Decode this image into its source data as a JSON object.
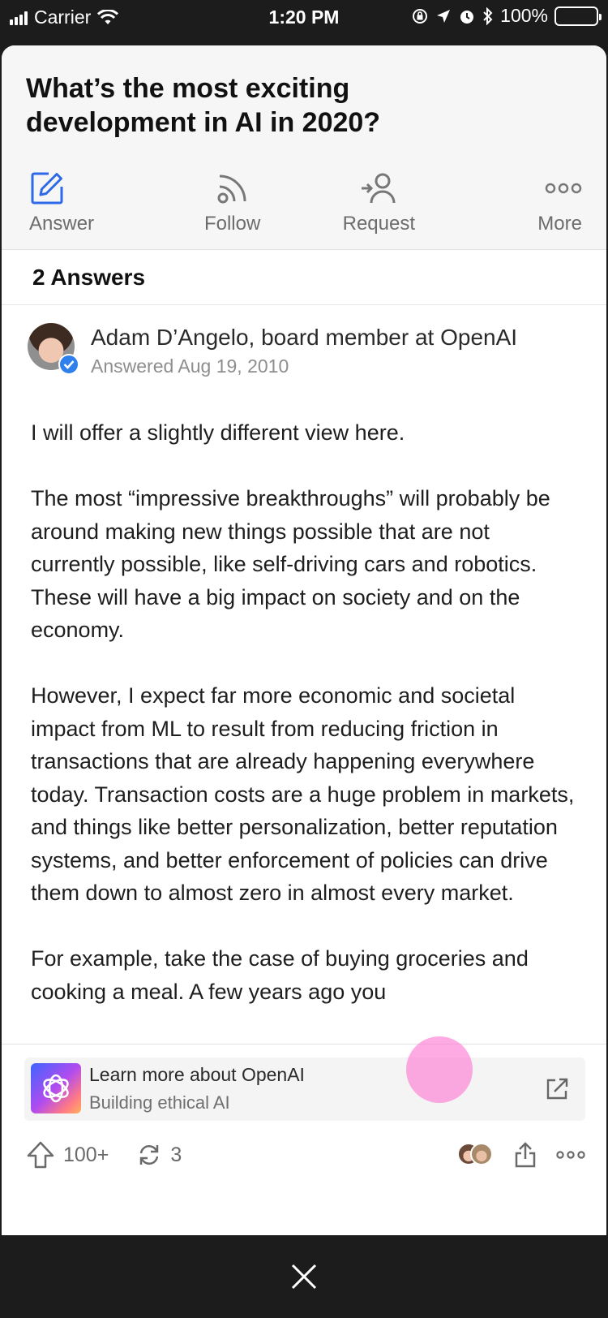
{
  "status_bar": {
    "carrier": "Carrier",
    "time": "1:20 PM",
    "battery": "100%"
  },
  "question": {
    "title": "What’s the most exciting development in AI in 2020?"
  },
  "actions": [
    {
      "label": "Answer",
      "icon": "edit-pencil-icon",
      "color": "#2e69e8"
    },
    {
      "label": "Follow",
      "icon": "rss-follow-icon"
    },
    {
      "label": "Request",
      "icon": "request-person-icon"
    },
    {
      "label": "More",
      "icon": "more-dots-icon"
    }
  ],
  "answers_header": "2 Answers",
  "answer": {
    "author": "Adam D’Angelo, board member at OpenAI",
    "date": "Answered Aug 19, 2010",
    "verified_icon": "verified-check-icon",
    "paragraphs": [
      "I will offer a slightly different view here.",
      "The most “impressive breakthroughs” will probably be around making new things possible that are not currently possible, like self-driving cars and robotics. These will have a big impact on society and on the economy.",
      "However, I expect far more economic and societal impact from ML to result from reducing friction in transactions that are already happening everywhere today. Transaction costs are a huge problem in markets, and things like better personalization, better reputation systems, and better enforcement of policies can drive them down to almost zero in almost every market.",
      "For example, take the case of buying groceries and cooking a meal. A few years ago you"
    ]
  },
  "promo": {
    "title": "Learn more about OpenAI",
    "subtitle": "Building ethical AI",
    "logo_icon": "openai-logo-icon",
    "link_icon": "external-link-icon"
  },
  "footer": {
    "upvotes": "100+",
    "shares": "3",
    "upvote_icon": "upvote-arrow-icon",
    "share_icon": "reshare-icon"
  },
  "close_icon": "close-icon"
}
